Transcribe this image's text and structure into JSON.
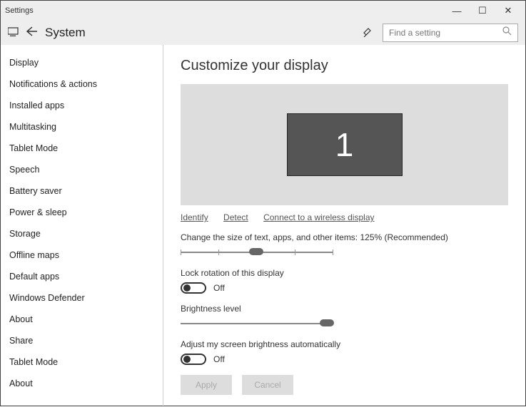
{
  "titlebar": {
    "title": "Settings"
  },
  "header": {
    "title": "System",
    "search_placeholder": "Find a setting"
  },
  "sidebar": {
    "items": [
      {
        "label": "Display"
      },
      {
        "label": "Notifications & actions"
      },
      {
        "label": "Installed apps"
      },
      {
        "label": "Multitasking"
      },
      {
        "label": "Tablet Mode"
      },
      {
        "label": "Speech"
      },
      {
        "label": "Battery saver"
      },
      {
        "label": "Power & sleep"
      },
      {
        "label": "Storage"
      },
      {
        "label": "Offline maps"
      },
      {
        "label": "Default apps"
      },
      {
        "label": "Windows Defender"
      },
      {
        "label": "About"
      },
      {
        "label": "Share"
      },
      {
        "label": "Tablet Mode"
      },
      {
        "label": "About"
      }
    ]
  },
  "main": {
    "heading": "Customize your display",
    "monitor_number": "1",
    "links": {
      "identify": "Identify",
      "detect": "Detect",
      "connect": "Connect to a wireless display"
    },
    "scale_label": "Change the size of text, apps, and other items: 125% (Recommended)",
    "lock_rotation_label": "Lock rotation of this display",
    "lock_rotation_state": "Off",
    "brightness_label": "Brightness level",
    "auto_brightness_label": "Adjust my screen brightness automatically",
    "auto_brightness_state": "Off",
    "apply_label": "Apply",
    "cancel_label": "Cancel"
  }
}
